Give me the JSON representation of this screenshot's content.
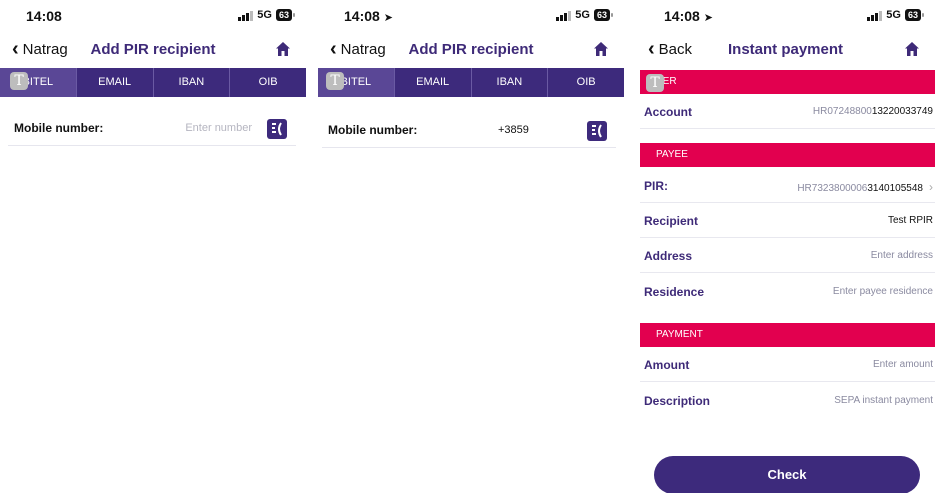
{
  "screens": [
    {
      "status": {
        "time": "14:08",
        "network": "5G",
        "battery": "63"
      },
      "nav": {
        "back_label": "Natrag",
        "title": "Add PIR recipient"
      },
      "tabs": [
        "BITEL",
        "EMAIL",
        "IBAN",
        "OIB"
      ],
      "badge_letter": "T",
      "mobile": {
        "label": "Mobile number:",
        "placeholder": "Enter number",
        "value": ""
      }
    },
    {
      "status": {
        "time": "14:08",
        "network": "5G",
        "battery": "63"
      },
      "nav": {
        "back_label": "Natrag",
        "title": "Add PIR recipient"
      },
      "tabs": [
        "BITEL",
        "EMAIL",
        "IBAN",
        "OIB"
      ],
      "badge_letter": "T",
      "mobile": {
        "label": "Mobile number:",
        "placeholder": "",
        "value": "+3859"
      }
    },
    {
      "status": {
        "time": "14:08",
        "network": "5G",
        "battery": "63"
      },
      "nav": {
        "back_label": "Back",
        "title": "Instant payment"
      },
      "badge_letter": "T",
      "payer": {
        "section": "YER",
        "account_label": "Account",
        "account_prefix": "HR07248800",
        "account_suffix": "13220033749"
      },
      "payee": {
        "section": "PAYEE",
        "pir_label": "PIR:",
        "pir_prefix": "HR7323800006",
        "pir_suffix": "3140105548",
        "recipient_label": "Recipient",
        "recipient_value": "Test RPIR",
        "address_label": "Address",
        "address_placeholder": "Enter address",
        "residence_label": "Residence",
        "residence_placeholder": "Enter payee residence"
      },
      "payment": {
        "section": "PAYMENT",
        "amount_label": "Amount",
        "amount_placeholder": "Enter amount",
        "description_label": "Description",
        "description_value": "SEPA instant payment"
      },
      "check_label": "Check"
    }
  ],
  "colors": {
    "primary_purple": "#3d2a7c",
    "accent_pink": "#e2004f",
    "title_purple": "#3e2a78"
  },
  "icons": [
    "chevron-left-icon",
    "home-icon",
    "contacts-icon",
    "signal-icon",
    "battery-icon",
    "location-arrow-icon"
  ]
}
